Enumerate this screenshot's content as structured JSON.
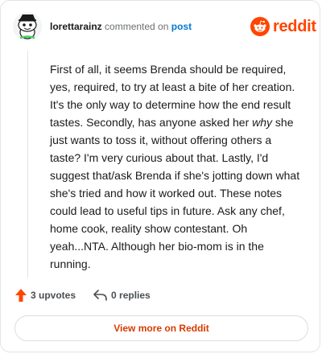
{
  "header": {
    "username": "lorettarainz",
    "action_text": " commented on ",
    "post_link": "post",
    "brand_name": "reddit"
  },
  "comment": {
    "text_before_emphasis": "First of all, it seems Brenda should be required, yes, required, to try at least a bite of her creation. It's the only way to determine how the end result tastes. Secondly, has anyone asked her ",
    "emphasis": "why",
    "text_after_emphasis": " she just wants to toss it, without offering others a taste? I'm very curious about that. Lastly, I'd suggest that/ask Brenda if she's jotting down what she's tried and how it worked out. These notes could lead to useful tips in future. Ask any chef, home cook, reality show contestant. Oh yeah...NTA. Although her bio-mom is in the running."
  },
  "footer": {
    "upvotes_label": "3 upvotes",
    "replies_label": "0 replies",
    "view_more_label": "View more on Reddit"
  },
  "icons": {
    "avatar": "snoo-avatar-icon",
    "brand": "reddit-snoo-icon",
    "upvote": "upvote-arrow-icon",
    "reply": "reply-arrow-icon"
  },
  "colors": {
    "brand_orange": "#ff4500",
    "link_blue": "#0079d3",
    "view_more_text": "#d93a00",
    "muted_text": "#6b6f73"
  }
}
